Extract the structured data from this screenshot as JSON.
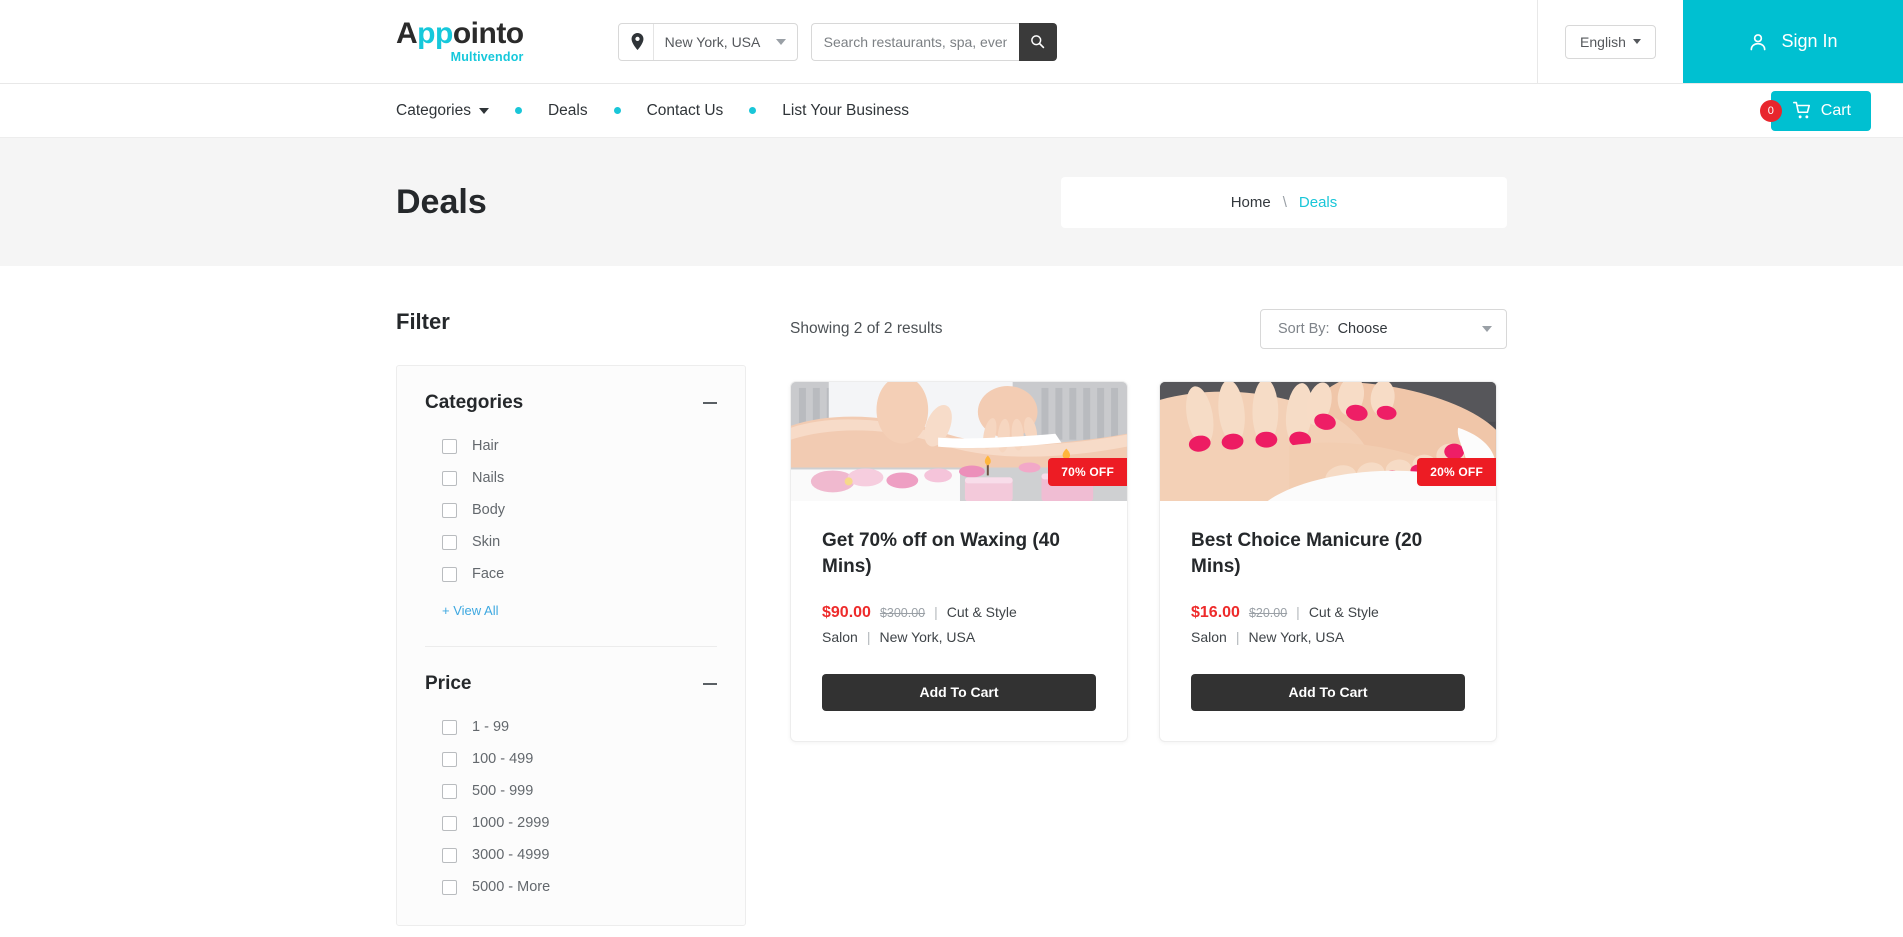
{
  "brand": {
    "name_part1": "A",
    "name_part2": "pp",
    "name_part3": "ointo",
    "tagline": "Multivendor",
    "accent_color": "#16c8db"
  },
  "header": {
    "location": {
      "value": "New York, USA",
      "icon": "map-pin-icon"
    },
    "search": {
      "placeholder": "Search restaurants, spa, events etc...",
      "value": "",
      "button_icon": "search-icon"
    },
    "language": {
      "label": "English"
    },
    "sign_in": {
      "label": "Sign In",
      "icon": "user-icon",
      "background": "#00c0d1"
    }
  },
  "nav": {
    "items": [
      {
        "label": "Categories",
        "has_caret": true
      },
      {
        "label": "Deals",
        "has_caret": false
      },
      {
        "label": "Contact Us",
        "has_caret": false
      },
      {
        "label": "List Your Business",
        "has_caret": false
      }
    ],
    "cart": {
      "label": "Cart",
      "count": "0",
      "icon": "shopping-cart-icon",
      "badge_color": "#e8262d"
    }
  },
  "page": {
    "title": "Deals",
    "breadcrumb": {
      "home": "Home",
      "separator": "\\",
      "current": "Deals"
    }
  },
  "sidebar": {
    "title": "Filter",
    "groups": [
      {
        "title": "Categories",
        "collapse_icon": "minus-icon",
        "options": [
          {
            "label": "Hair",
            "checked": false
          },
          {
            "label": "Nails",
            "checked": false
          },
          {
            "label": "Body",
            "checked": false
          },
          {
            "label": "Skin",
            "checked": false
          },
          {
            "label": "Face",
            "checked": false
          }
        ],
        "view_all": "+ View All"
      },
      {
        "title": "Price",
        "collapse_icon": "minus-icon",
        "options": [
          {
            "label": "1 - 99",
            "checked": false
          },
          {
            "label": "100 - 499",
            "checked": false
          },
          {
            "label": "500 - 999",
            "checked": false
          },
          {
            "label": "1000 - 2999",
            "checked": false
          },
          {
            "label": "3000 - 4999",
            "checked": false
          },
          {
            "label": "5000 - More",
            "checked": false
          }
        ]
      }
    ]
  },
  "results": {
    "showing": "Showing 2 of 2 results",
    "sort": {
      "label": "Sort By:",
      "value": "Choose"
    },
    "cards": [
      {
        "title": "Get 70% off on Waxing (40 Mins)",
        "badge": "70% OFF",
        "price_new": "$90.00",
        "price_old": "$300.00",
        "vendor": "Cut & Style Salon",
        "location": "New York, USA",
        "button": "Add To Cart",
        "image_alt": "waxing-spa-photo"
      },
      {
        "title": "Best Choice Manicure (20 Mins)",
        "badge": "20% OFF",
        "price_new": "$16.00",
        "price_old": "$20.00",
        "vendor": "Cut & Style Salon",
        "location": "New York, USA",
        "button": "Add To Cart",
        "image_alt": "manicure-pedicure-photo"
      }
    ]
  }
}
